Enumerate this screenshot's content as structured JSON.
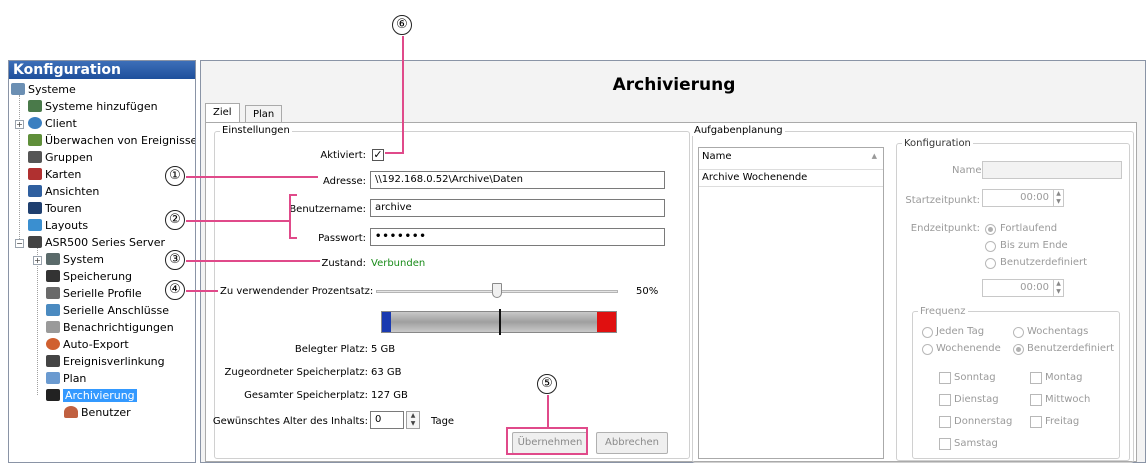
{
  "sidebar": {
    "title": "Konfiguration",
    "items": [
      {
        "label": "Systeme",
        "icon": "systems-icon"
      },
      {
        "label": "Systeme hinzufügen",
        "icon": "add-system-icon"
      },
      {
        "label": "Client",
        "icon": "client-gear-icon"
      },
      {
        "label": "Überwachen von Ereignissen",
        "icon": "event-monitor-icon"
      },
      {
        "label": "Gruppen",
        "icon": "groups-icon"
      },
      {
        "label": "Karten",
        "icon": "maps-icon"
      },
      {
        "label": "Ansichten",
        "icon": "views-icon"
      },
      {
        "label": "Touren",
        "icon": "tours-icon"
      },
      {
        "label": "Layouts",
        "icon": "layouts-icon"
      },
      {
        "label": "ASR500 Series Server",
        "icon": "server-icon"
      },
      {
        "label": "System",
        "icon": "system-icon"
      },
      {
        "label": "Speicherung",
        "icon": "storage-icon"
      },
      {
        "label": "Serielle Profile",
        "icon": "serial-profile-icon"
      },
      {
        "label": "Serielle Anschlüsse",
        "icon": "serial-port-icon"
      },
      {
        "label": "Benachrichtigungen",
        "icon": "mail-icon"
      },
      {
        "label": "Auto-Export",
        "icon": "auto-export-icon"
      },
      {
        "label": "Ereignisverlinkung",
        "icon": "event-link-icon"
      },
      {
        "label": "Plan",
        "icon": "calendar-icon"
      },
      {
        "label": "Archivierung",
        "icon": "archive-icon",
        "selected": true
      },
      {
        "label": "Benutzer",
        "icon": "user-icon"
      }
    ]
  },
  "main": {
    "title": "Archivierung",
    "tabs": [
      {
        "label": "Ziel",
        "active": true
      },
      {
        "label": "Plan",
        "active": false
      }
    ],
    "settings": {
      "legend": "Einstellungen",
      "aktiviert_label": "Aktiviert:",
      "aktiviert_checked": true,
      "adresse_label": "Adresse:",
      "adresse_value": "\\\\192.168.0.52\\Archive\\Daten",
      "benutzername_label": "Benutzername:",
      "benutzername_value": "archive",
      "passwort_label": "Passwort:",
      "passwort_value": "•••••••",
      "zustand_label": "Zustand:",
      "zustand_value": "Verbunden",
      "prozentsatz_label": "Zu verwendender Prozentsatz:",
      "prozentsatz_value": "50%",
      "prozentsatz_fraction": 0.5,
      "belegter_label": "Belegter Platz:",
      "belegter_value": "5 GB",
      "zugeordneter_label": "Zugeordneter Speicherplatz:",
      "zugeordneter_value": "63 GB",
      "gesamter_label": "Gesamter Speicherplatz:",
      "gesamter_value": "127 GB",
      "alter_label": "Gewünschtes Alter des Inhalts:",
      "alter_value": "0",
      "alter_unit": "Tage",
      "apply_label": "Übernehmen",
      "cancel_label": "Abbrechen"
    },
    "schedule": {
      "legend": "Aufgabenplanung",
      "column_header": "Name",
      "rows": [
        "Archive Wochenende"
      ],
      "config": {
        "legend": "Konfiguration",
        "name_label": "Name:",
        "start_label": "Startzeitpunkt:",
        "start_value": "00:00",
        "end_label": "Endzeitpunkt:",
        "end_options": [
          "Fortlaufend",
          "Bis zum Ende",
          "Benutzerdefiniert"
        ],
        "end_selected": "Fortlaufend",
        "end_value": "00:00",
        "frequency": {
          "legend": "Frequenz",
          "options": [
            "Jeden Tag",
            "Wochentags",
            "Wochenende",
            "Benutzerdefiniert"
          ],
          "selected": "Benutzerdefiniert",
          "days": [
            "Sonntag",
            "Montag",
            "Dienstag",
            "Mittwoch",
            "Donnerstag",
            "Freitag",
            "Samstag"
          ]
        }
      }
    }
  },
  "callouts": [
    "①",
    "②",
    "③",
    "④",
    "⑤",
    "⑥"
  ],
  "colors": {
    "callout_line": "#e04a8a",
    "status_ok": "#1a8c1a",
    "selection": "#3399ff",
    "header_blue": "#1e4f9c"
  }
}
